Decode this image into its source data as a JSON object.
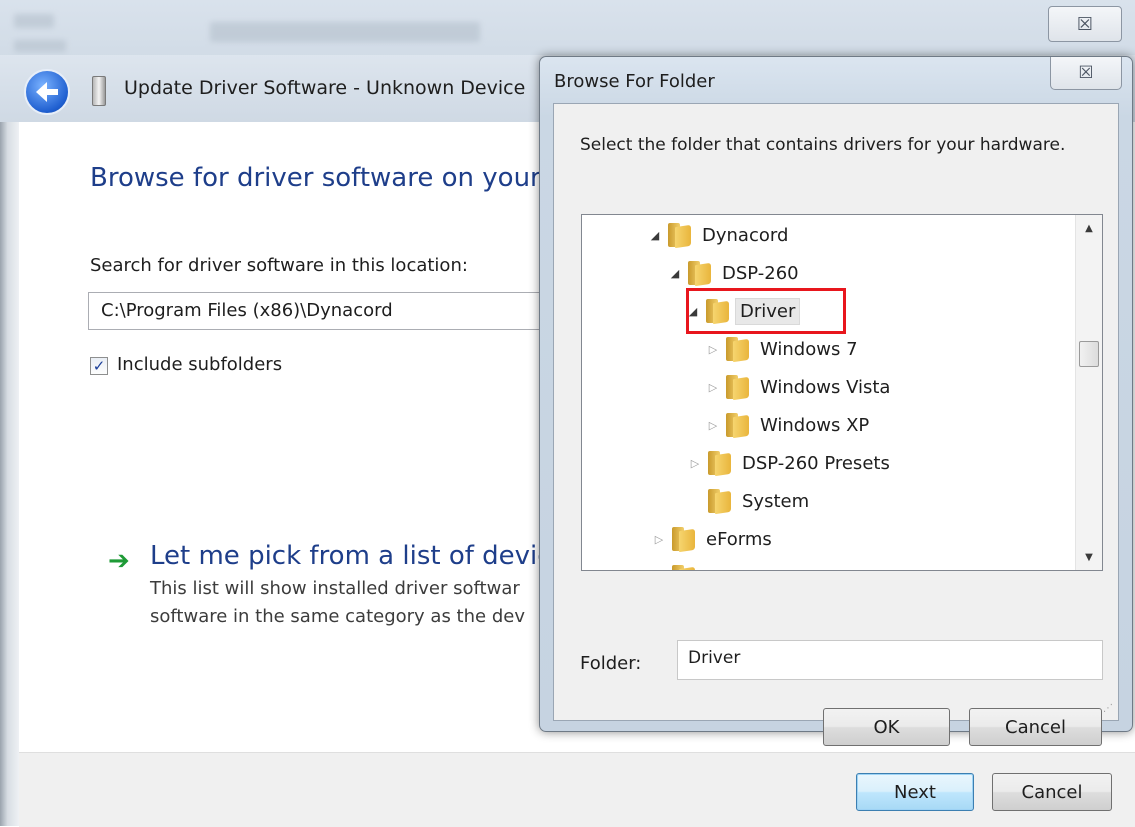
{
  "colors": {
    "heading_blue": "#1e3e8a",
    "highlight_red": "#e8161d",
    "link_green": "#1e9a36",
    "default_button_border": "#3c7fb1"
  },
  "background_window": {
    "close_glyph": "☒"
  },
  "wizard": {
    "title": "Update Driver Software - Unknown Device",
    "heading": "Browse for driver software on your",
    "search_label": "Search for driver software in this location:",
    "path_value": "C:\\Program Files (x86)\\Dynacord",
    "include_subfolders_label": "Include subfolders",
    "include_subfolders_checked": "✓",
    "pick_heading": "Let me pick from a list of device",
    "pick_desc_line1": "This list will show installed driver softwar",
    "pick_desc_line2": "software in the same category as the dev",
    "next_label": "Next",
    "cancel_label": "Cancel",
    "arrow_icon": "➔"
  },
  "browse_dialog": {
    "title": "Browse For Folder",
    "close_glyph": "☒",
    "instruction": "Select the folder that contains drivers for your hardware.",
    "tree": [
      {
        "label": "Dynacord",
        "expander": "◢",
        "state": "expanded"
      },
      {
        "label": "DSP-260",
        "expander": "◢",
        "state": "expanded"
      },
      {
        "label": "Driver",
        "expander": "◢",
        "state": "expanded",
        "selected": true
      },
      {
        "label": "Windows 7",
        "expander": "▷",
        "state": "collapsed"
      },
      {
        "label": "Windows Vista",
        "expander": "▷",
        "state": "collapsed"
      },
      {
        "label": "Windows XP",
        "expander": "▷",
        "state": "collapsed"
      },
      {
        "label": "DSP-260 Presets",
        "expander": "▷",
        "state": "collapsed"
      },
      {
        "label": "System",
        "expander": "",
        "state": "leaf"
      },
      {
        "label": "eForms",
        "expander": "▷",
        "state": "collapsed"
      }
    ],
    "scroll_up_glyph": "▲",
    "scroll_down_glyph": "▼",
    "folder_label": "Folder:",
    "folder_value": "Driver",
    "ok_label": "OK",
    "cancel_label": "Cancel",
    "resize_grip": "⋰"
  }
}
